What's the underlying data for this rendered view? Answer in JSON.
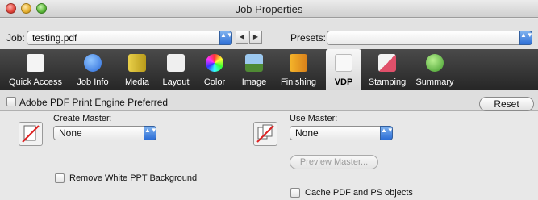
{
  "window": {
    "title": "Job Properties"
  },
  "jobbar": {
    "job_label": "Job:",
    "job_value": "testing.pdf",
    "presets_label": "Presets:",
    "presets_value": "",
    "prev_glyph": "◀",
    "next_glyph": "▶",
    "stepper_glyph": "▲▼"
  },
  "toolbar": {
    "items": [
      {
        "label": "Quick Access",
        "icon": "document-icon"
      },
      {
        "label": "Job Info",
        "icon": "info-icon"
      },
      {
        "label": "Media",
        "icon": "media-stack-icon"
      },
      {
        "label": "Layout",
        "icon": "layout-icon"
      },
      {
        "label": "Color",
        "icon": "color-wheel-icon"
      },
      {
        "label": "Image",
        "icon": "image-icon"
      },
      {
        "label": "Finishing",
        "icon": "finishing-icon"
      },
      {
        "label": "VDP",
        "icon": "vdp-icon",
        "active": true
      },
      {
        "label": "Stamping",
        "icon": "stamp-icon"
      },
      {
        "label": "Summary",
        "icon": "checkmark-icon"
      }
    ]
  },
  "options": {
    "adobe_label": "Adobe PDF Print Engine Preferred",
    "adobe_checked": false,
    "reset_label": "Reset"
  },
  "vdp": {
    "create_master_label": "Create Master:",
    "create_master_value": "None",
    "use_master_label": "Use Master:",
    "use_master_value": "None",
    "preview_master_label": "Preview Master...",
    "remove_white_label": "Remove White PPT Background",
    "remove_white_checked": false,
    "cache_label": "Cache PDF and PS objects",
    "cache_checked": false
  },
  "colors": {
    "toolbar_bg": "#2f2f2f",
    "stepper_blue": "#2c6ed6"
  }
}
